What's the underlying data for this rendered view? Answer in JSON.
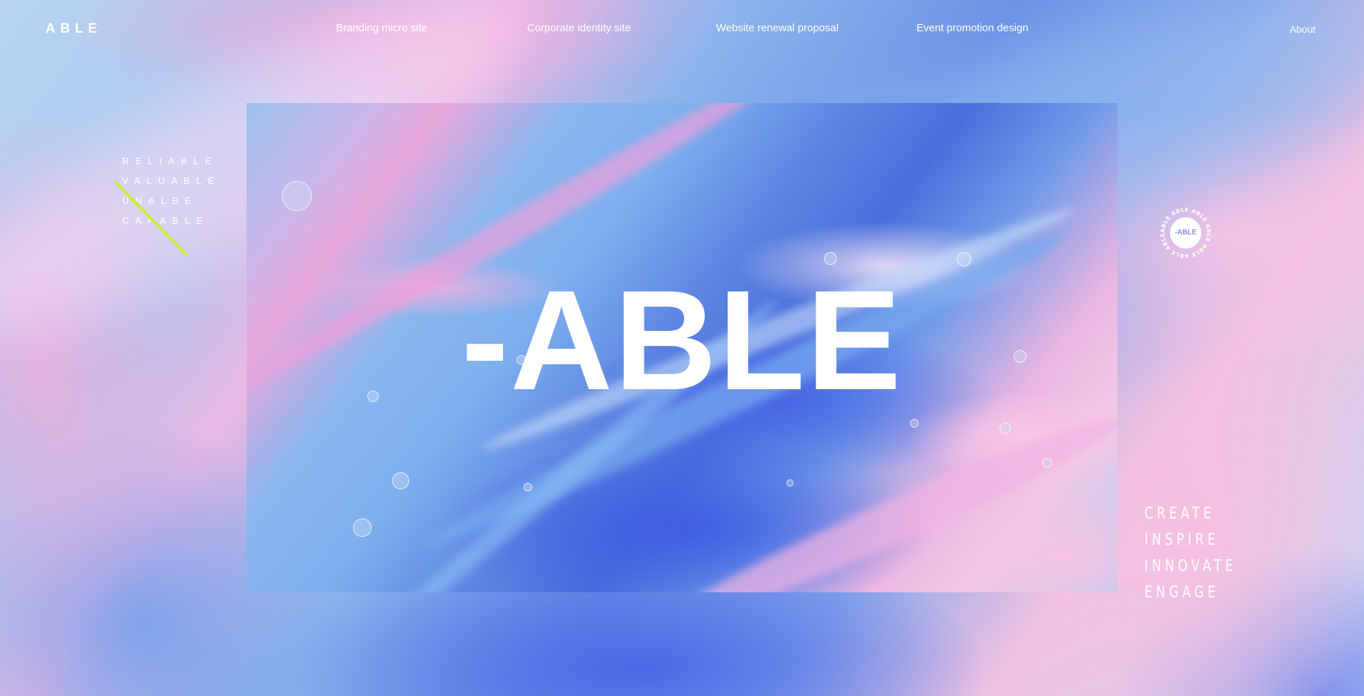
{
  "header": {
    "logo": "ABLE",
    "nav": [
      {
        "label": "Branding micro site"
      },
      {
        "label": "Corporate identity site"
      },
      {
        "label": "Website renewal proposal"
      },
      {
        "label": "Event promotion design"
      }
    ],
    "about": "About"
  },
  "side_words": [
    "RELIABLE",
    "VALUABLE",
    "UNALBE",
    "CAPABLE"
  ],
  "hero": {
    "title": "-ABLE"
  },
  "badge": {
    "ring_text": "ABLE ABLE ABLE ABLE ABLE ABLE ABLE",
    "center_text": "-ABLE"
  },
  "values": [
    "CREATE",
    "INSPIRE",
    "INNOVATE",
    "ENGAGE"
  ],
  "colors": {
    "accent_line": "#c8f03c",
    "text": "#ffffff",
    "badge_text": "#8a8fd8"
  }
}
